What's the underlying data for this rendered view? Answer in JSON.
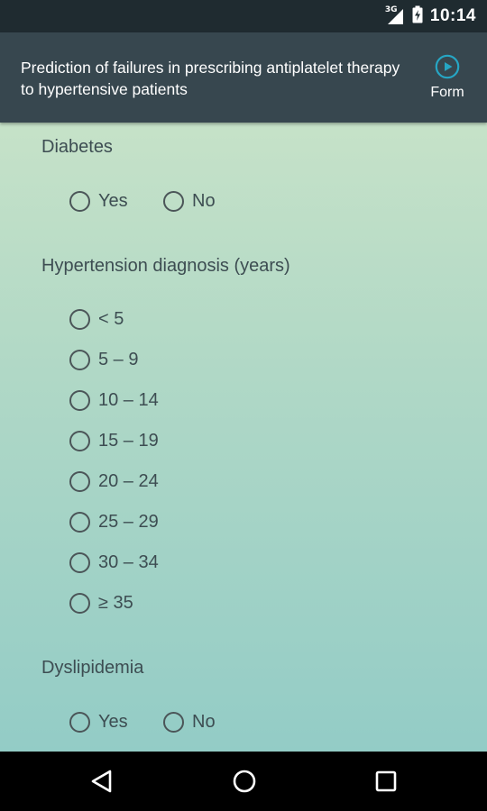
{
  "status_bar": {
    "network_label": "3G",
    "time": "10:14",
    "icons": [
      "signal-icon",
      "battery-icon"
    ]
  },
  "header": {
    "title": "Prediction of failures in prescribing antiplatelet therapy to hypertensive patients",
    "action_icon": "play-circle-icon",
    "action_label": "Form"
  },
  "form": {
    "diabetes": {
      "label": "Diabetes",
      "options": [
        "Yes",
        "No"
      ]
    },
    "hypertension": {
      "label": "Hypertension diagnosis (years)",
      "options": [
        "< 5",
        "5 – 9",
        "10 – 14",
        "15 – 19",
        "20 – 24",
        "25 – 29",
        "30 – 34",
        "≥ 35"
      ]
    },
    "dyslipidemia": {
      "label": "Dyslipidemia",
      "options": [
        "Yes",
        "No"
      ]
    }
  },
  "nav_bar": {
    "buttons": [
      "back-icon",
      "home-icon",
      "recents-icon"
    ]
  },
  "colors": {
    "status_bar": "#1f2b30",
    "app_bar": "#37474f",
    "accent": "#26a6c4",
    "gradient_top": "#c6e2c8",
    "gradient_bottom": "#93ccc6"
  }
}
